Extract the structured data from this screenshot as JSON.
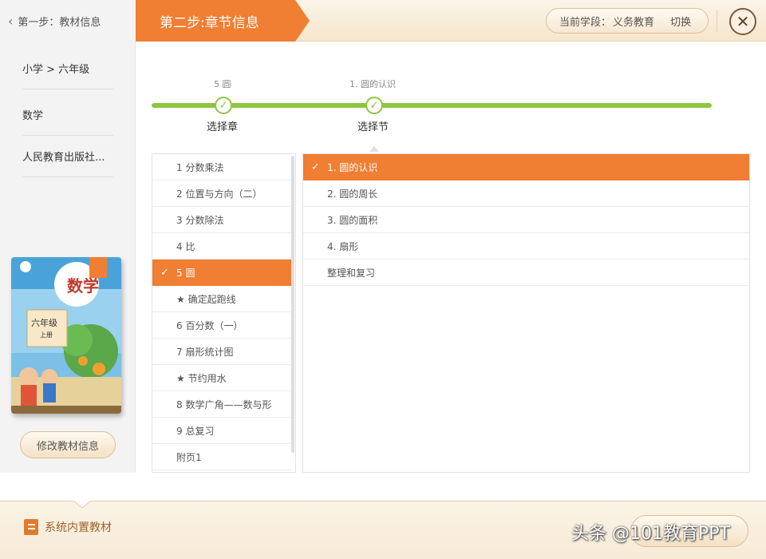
{
  "header": {
    "step1_label": "第一步：教材信息",
    "step2_label": "第二步:章节信息",
    "stage_label": "当前学段：",
    "stage_value": "义务教育",
    "switch_label": "切换",
    "close_glyph": "✕"
  },
  "sidebar": {
    "items": [
      {
        "label": "小学 > 六年级"
      },
      {
        "label": "数学"
      },
      {
        "label": "人民教育出版社..."
      }
    ],
    "book": {
      "title": "数学",
      "grade": "六年级",
      "volume": "上册"
    },
    "modify_label": "修改教材信息"
  },
  "progress": {
    "steps": [
      {
        "top_label": "5 圆",
        "name": "选择章"
      },
      {
        "top_label": "1. 圆的认识",
        "name": "选择节"
      }
    ],
    "check_glyph": "✓"
  },
  "chapters": {
    "items": [
      {
        "label": "1 分数乘法",
        "selected": false
      },
      {
        "label": "2 位置与方向（二）",
        "selected": false
      },
      {
        "label": "3 分数除法",
        "selected": false
      },
      {
        "label": "4 比",
        "selected": false
      },
      {
        "label": "5 圆",
        "selected": true
      },
      {
        "label": "★ 确定起跑线",
        "selected": false
      },
      {
        "label": "6 百分数（一）",
        "selected": false
      },
      {
        "label": "7 扇形统计图",
        "selected": false
      },
      {
        "label": "★ 节约用水",
        "selected": false
      },
      {
        "label": "8 数学广角——数与形",
        "selected": false
      },
      {
        "label": "9 总复习",
        "selected": false
      },
      {
        "label": "附页1",
        "selected": false
      }
    ]
  },
  "sections": {
    "items": [
      {
        "label": "1. 圆的认识",
        "selected": true
      },
      {
        "label": "2. 圆的周长",
        "selected": false
      },
      {
        "label": "3. 圆的面积",
        "selected": false
      },
      {
        "label": "4. 扇形",
        "selected": false
      },
      {
        "label": "整理和复习",
        "selected": false
      }
    ]
  },
  "footer": {
    "builtin_label": "系统内置教材",
    "watermark": "头条 @101教育PPT"
  },
  "colors": {
    "accent": "#f07e33",
    "progress": "#8dc63f"
  }
}
